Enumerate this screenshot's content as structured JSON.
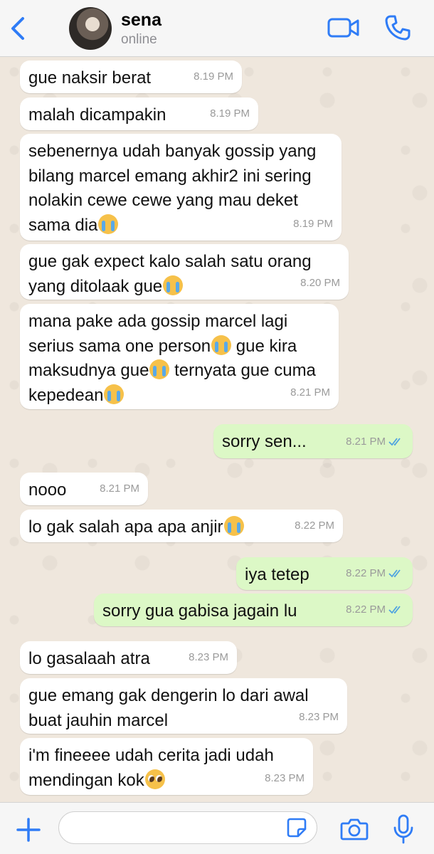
{
  "header": {
    "contact_name": "sena",
    "status": "online",
    "icons": {
      "back": "chevron-left-icon",
      "video": "video-camera-icon",
      "call": "phone-icon"
    },
    "accent_color": "#2f7cf6"
  },
  "messages": [
    {
      "dir": "in",
      "parts": [
        "gue naksir berat"
      ],
      "time": "8.19 PM"
    },
    {
      "dir": "in",
      "parts": [
        "malah dicampakin"
      ],
      "time": "8.19 PM"
    },
    {
      "dir": "in",
      "parts": [
        "sebenernya udah banyak gossip yang bilang marcel emang akhir2 ini sering nolakin cewe cewe yang mau deket sama dia",
        {
          "emoji": "loudly-crying-face"
        }
      ],
      "time": "8.19 PM"
    },
    {
      "dir": "in",
      "parts": [
        "gue gak expect kalo salah satu orang yang ditolaak gue",
        {
          "emoji": "loudly-crying-face"
        }
      ],
      "time": "8.20 PM"
    },
    {
      "dir": "in",
      "parts": [
        "mana pake ada gossip marcel lagi serius sama one person",
        {
          "emoji": "loudly-crying-face"
        },
        "  gue kira maksudnya gue",
        {
          "emoji": "loudly-crying-face"
        },
        "  ternyata gue cuma kepedean",
        {
          "emoji": "loudly-crying-face"
        }
      ],
      "time": "8.21 PM"
    },
    {
      "dir": "out",
      "parts": [
        "sorry sen..."
      ],
      "time": "8.21 PM",
      "read": true
    },
    {
      "dir": "in",
      "parts": [
        "nooo"
      ],
      "time": "8.21 PM"
    },
    {
      "dir": "in",
      "parts": [
        "lo gak salah apa apa anjir",
        {
          "emoji": "loudly-crying-face"
        }
      ],
      "time": "8.22 PM"
    },
    {
      "dir": "out",
      "parts": [
        "iya tetep"
      ],
      "time": "8.22 PM",
      "read": true
    },
    {
      "dir": "out",
      "parts": [
        "sorry gua gabisa jagain lu"
      ],
      "time": "8.22 PM",
      "read": true
    },
    {
      "dir": "in",
      "parts": [
        "lo gasalaah atra"
      ],
      "time": "8.23 PM"
    },
    {
      "dir": "in",
      "parts": [
        "gue emang gak dengerin lo dari awal buat jauhin marcel"
      ],
      "time": "8.23 PM"
    },
    {
      "dir": "in",
      "parts": [
        "i'm fineeee udah cerita jadi udah mendingan kok",
        {
          "emoji": "pleading-face"
        }
      ],
      "time": "8.23 PM"
    }
  ],
  "footer": {
    "input_placeholder": "",
    "icons": {
      "attach": "plus-icon",
      "sticker": "sticker-icon",
      "camera": "camera-icon",
      "mic": "microphone-icon"
    }
  },
  "colors": {
    "incoming": "#ffffff",
    "outgoing": "#dcf8c6",
    "read_ticks": "#4fa3e0",
    "background": "#efe7dd"
  }
}
